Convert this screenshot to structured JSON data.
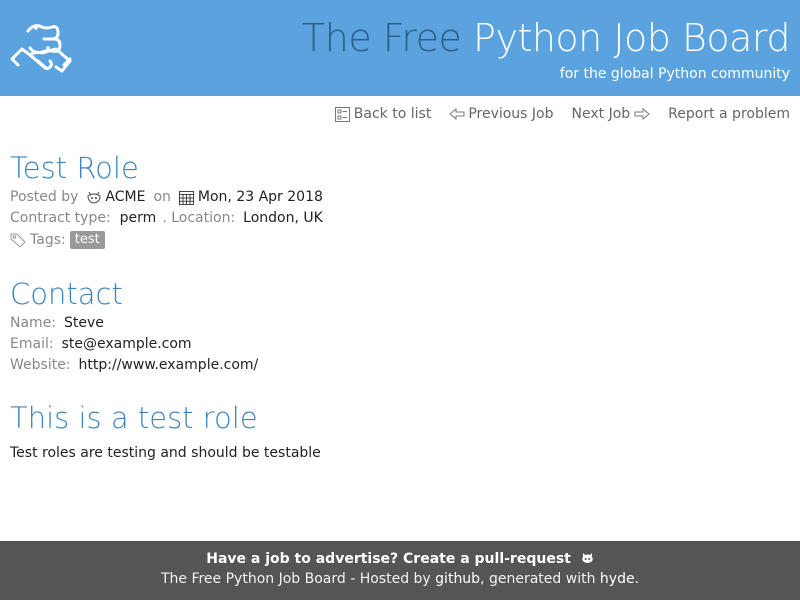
{
  "header": {
    "title_part1": "The Free",
    "title_part2": "Python Job Board",
    "tagline": "for the global Python community"
  },
  "nav": {
    "back": "Back to list",
    "previous": "Previous Job",
    "next": "Next Job",
    "report": "Report a problem"
  },
  "job": {
    "title": "Test Role",
    "posted_by_label": "Posted by",
    "company": "ACME",
    "on_label": "on",
    "date": "Mon, 23 Apr 2018",
    "contract_label": "Contract type:",
    "contract_type": "perm",
    "location_label": ". Location:",
    "location": "London, UK",
    "tags_label": "Tags:",
    "tags": [
      "test"
    ]
  },
  "contact": {
    "heading": "Contact",
    "name_label": "Name:",
    "name": "Steve",
    "email_label": "Email:",
    "email": "ste@example.com",
    "website_label": "Website:",
    "website": "http://www.example.com/"
  },
  "description": {
    "heading": "This is a test role",
    "text": "Test roles are testing and should be testable"
  },
  "footer": {
    "cta": "Have a job to advertise? Create a pull-request",
    "credits_prefix": "The Free Python Job Board - Hosted by",
    "github": "github",
    "generated": ", generated with",
    "hyde": "hyde",
    "end": "."
  },
  "colors": {
    "header_bg": "#5aa3de",
    "heading": "#3a84c3",
    "footer_bg": "#555555",
    "tag_bg": "#999999"
  }
}
